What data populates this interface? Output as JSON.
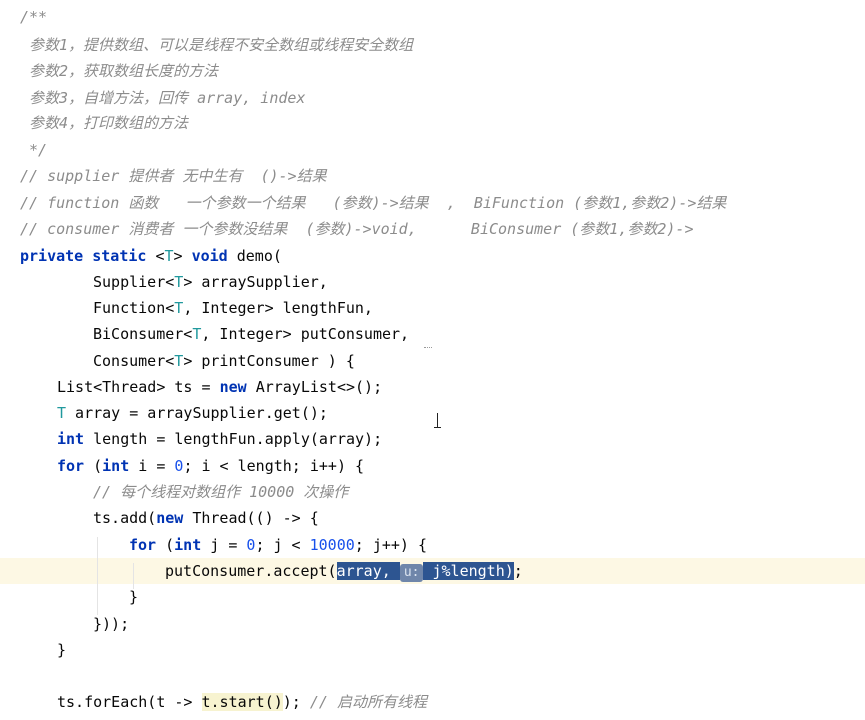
{
  "editor": {
    "lines": [
      {
        "indent": 20,
        "tokens": [
          {
            "t": "cm",
            "v": "/**"
          }
        ]
      },
      {
        "indent": 20,
        "tokens": [
          {
            "t": "cm",
            "v": " 参数1，提供数组、可以是线程不安全数组或线程安全数组"
          }
        ]
      },
      {
        "indent": 20,
        "tokens": [
          {
            "t": "cm",
            "v": " 参数2，获取数组长度的方法"
          }
        ]
      },
      {
        "indent": 20,
        "tokens": [
          {
            "t": "cm",
            "v": " 参数3，自增方法，回传 array, index"
          }
        ]
      },
      {
        "indent": 20,
        "tokens": [
          {
            "t": "cm",
            "v": " 参数4，打印数组的方法"
          }
        ]
      },
      {
        "indent": 20,
        "tokens": [
          {
            "t": "cm",
            "v": " */"
          }
        ]
      },
      {
        "indent": 20,
        "tokens": [
          {
            "t": "cm",
            "v": "// supplier 提供者 无中生有  ()->结果"
          }
        ]
      },
      {
        "indent": 20,
        "tokens": [
          {
            "t": "cm",
            "v": "// function 函数   一个参数一个结果   (参数)->结果  ,  BiFunction (参数1,参数2)->结果"
          }
        ]
      },
      {
        "indent": 20,
        "tokens": [
          {
            "t": "cm",
            "v": "// consumer 消费者 一个参数没结果  (参数)->void,      BiConsumer (参数1,参数2)->"
          }
        ]
      },
      {
        "indent": 20,
        "tokens": [
          {
            "t": "kw",
            "v": "private static "
          },
          {
            "t": "plain",
            "v": "<"
          },
          {
            "t": "tp",
            "v": "T"
          },
          {
            "t": "plain",
            "v": "> "
          },
          {
            "t": "kw",
            "v": "void "
          },
          {
            "t": "plain",
            "v": "demo("
          }
        ]
      },
      {
        "indent": 93,
        "tokens": [
          {
            "t": "plain",
            "v": "Supplier<"
          },
          {
            "t": "tp",
            "v": "T"
          },
          {
            "t": "plain",
            "v": "> arraySupplier,"
          }
        ]
      },
      {
        "indent": 93,
        "tokens": [
          {
            "t": "plain",
            "v": "Function<"
          },
          {
            "t": "tp",
            "v": "T"
          },
          {
            "t": "plain",
            "v": ", Integer> lengthFun,"
          }
        ]
      },
      {
        "indent": 93,
        "tokens": [
          {
            "t": "plain",
            "v": "BiConsumer<"
          },
          {
            "t": "tp",
            "v": "T"
          },
          {
            "t": "plain",
            "v": ", Integer> putConsumer,"
          }
        ]
      },
      {
        "indent": 93,
        "tokens": [
          {
            "t": "plain",
            "v": "Consumer<"
          },
          {
            "t": "tp",
            "v": "T"
          },
          {
            "t": "plain",
            "v": "> printConsumer ) {"
          }
        ]
      },
      {
        "indent": 57,
        "tokens": [
          {
            "t": "plain",
            "v": "List<Thread> ts = "
          },
          {
            "t": "kw",
            "v": "new "
          },
          {
            "t": "plain",
            "v": "ArrayList<>();"
          }
        ]
      },
      {
        "indent": 57,
        "tokens": [
          {
            "t": "tp",
            "v": "T"
          },
          {
            "t": "plain",
            "v": " array = arraySupplier.get();"
          }
        ]
      },
      {
        "indent": 57,
        "tokens": [
          {
            "t": "kw",
            "v": "int "
          },
          {
            "t": "plain",
            "v": "length = lengthFun.apply(array);"
          }
        ]
      },
      {
        "indent": 57,
        "tokens": [
          {
            "t": "kw",
            "v": "for "
          },
          {
            "t": "plain",
            "v": "("
          },
          {
            "t": "kw",
            "v": "int "
          },
          {
            "t": "plain",
            "v": "i = "
          },
          {
            "t": "num",
            "v": "0"
          },
          {
            "t": "plain",
            "v": "; i < length; i++) {"
          }
        ]
      },
      {
        "indent": 93,
        "tokens": [
          {
            "t": "cm",
            "v": "// 每个线程对数组作 10000 次操作"
          }
        ]
      },
      {
        "indent": 93,
        "tokens": [
          {
            "t": "plain",
            "v": "ts.add("
          },
          {
            "t": "kw",
            "v": "new "
          },
          {
            "t": "plain",
            "v": "Thread(() -> {"
          }
        ]
      },
      {
        "indent": 129,
        "tokens": [
          {
            "t": "kw",
            "v": "for "
          },
          {
            "t": "plain",
            "v": "("
          },
          {
            "t": "kw",
            "v": "int "
          },
          {
            "t": "plain",
            "v": "j = "
          },
          {
            "t": "num",
            "v": "0"
          },
          {
            "t": "plain",
            "v": "; j < "
          },
          {
            "t": "num",
            "v": "10000"
          },
          {
            "t": "plain",
            "v": "; j++) {"
          }
        ]
      },
      {
        "indent": 165,
        "current": true,
        "tokens": [
          {
            "t": "plain",
            "v": "putConsumer.accept("
          },
          {
            "t": "sel",
            "v": "array, "
          },
          {
            "t": "hint",
            "v": "u:"
          },
          {
            "t": "sel",
            "v": " j%length"
          },
          {
            "t": "sel",
            "v": ")"
          },
          {
            "t": "plain",
            "v": ";"
          }
        ]
      },
      {
        "indent": 129,
        "tokens": [
          {
            "t": "plain",
            "v": "}"
          }
        ]
      },
      {
        "indent": 93,
        "tokens": [
          {
            "t": "plain",
            "v": "}));"
          }
        ]
      },
      {
        "indent": 57,
        "tokens": [
          {
            "t": "plain",
            "v": "}"
          }
        ]
      },
      {
        "indent": 57,
        "tokens": []
      },
      {
        "indent": 57,
        "tokens": [
          {
            "t": "plain",
            "v": "ts.forEach(t -> "
          },
          {
            "t": "hl",
            "v": "t.start()"
          },
          {
            "t": "plain",
            "v": "); "
          },
          {
            "t": "cm",
            "v": "// 启动所有线程"
          }
        ]
      }
    ]
  }
}
